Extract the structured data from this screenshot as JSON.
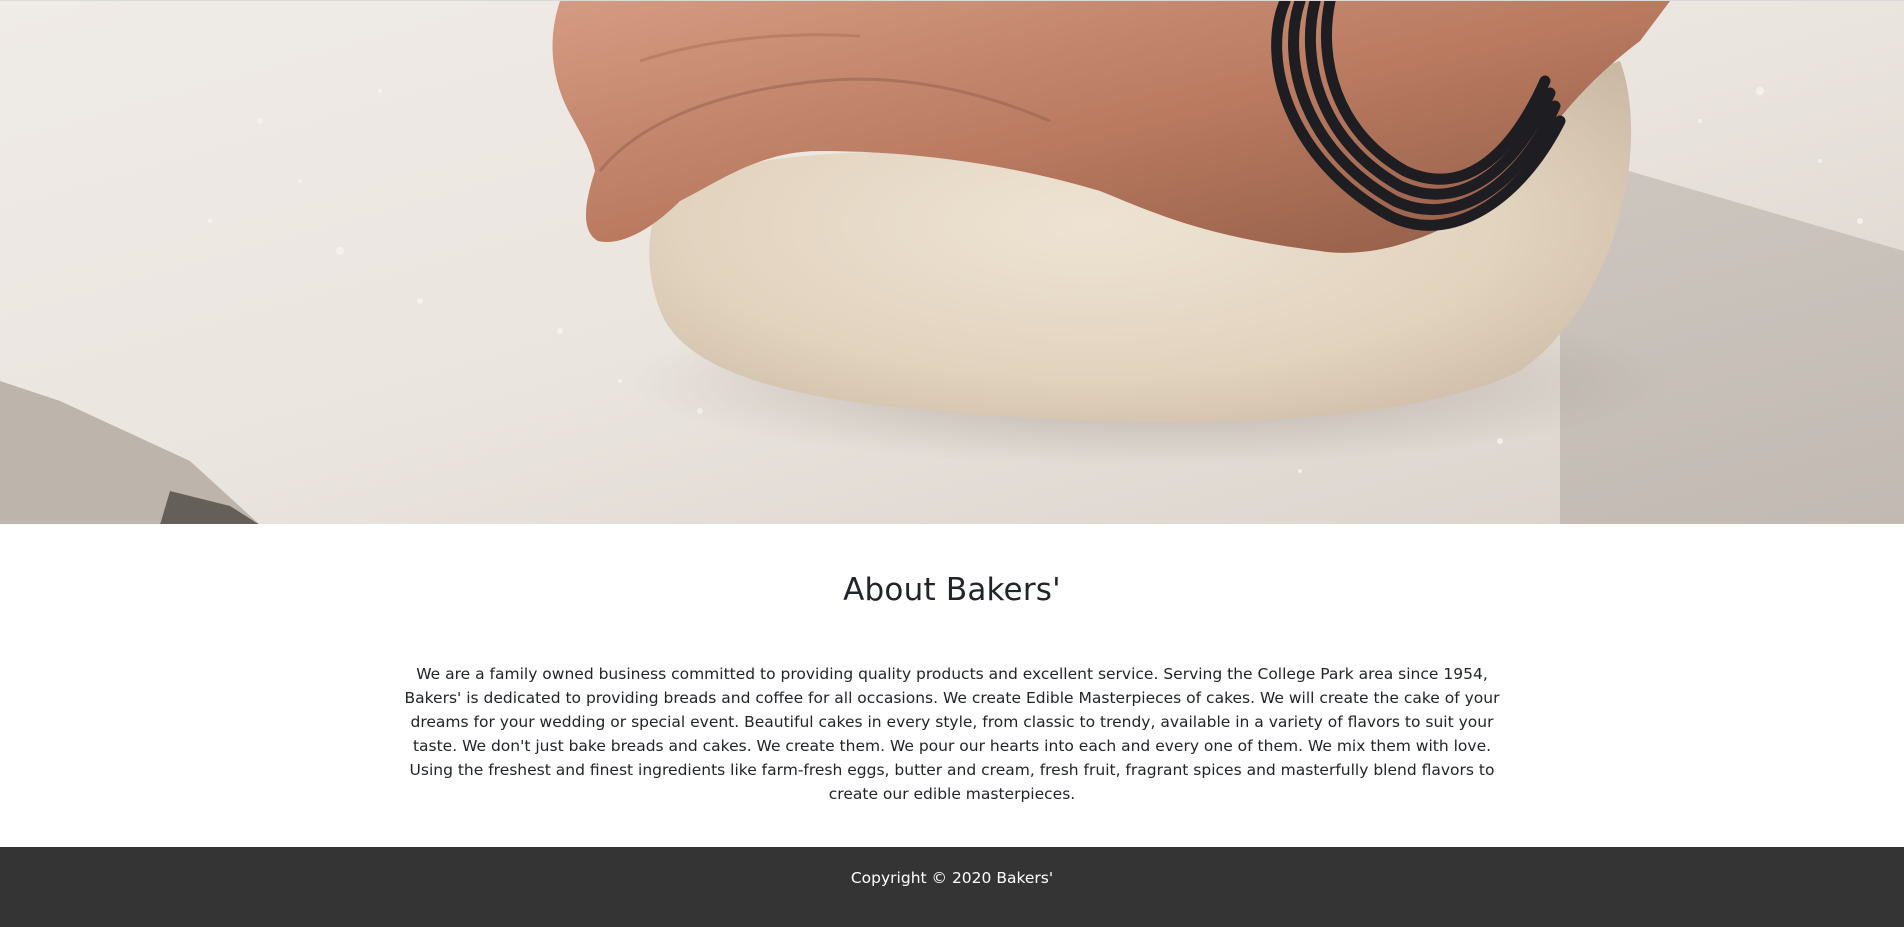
{
  "hero": {
    "image_description_icon": "dough-kneading-photo",
    "colors": {
      "flour_bg": "#ece7e2",
      "dough": "#e5d7c4",
      "skin": "#c9876c",
      "band": "#1e1e22"
    }
  },
  "about": {
    "title": "About Bakers'",
    "paragraph": "We are a family owned business committed to providing quality products and excellent service. Serving the College Park area since 1954, Bakers' is dedicated to providing breads and coffee for all occasions. We create Edible Masterpieces of cakes. We will create the cake of your dreams for your wedding or special event. Beautiful cakes in every style, from classic to trendy, available in a variety of flavors to suit your taste. We don't just bake breads and cakes. We create them. We pour our hearts into each and every one of them. We mix them with love. Using the freshest and finest ingredients like farm-fresh eggs, butter and cream, fresh fruit, fragrant spices and masterfully blend flavors to create our edible masterpieces."
  },
  "footer": {
    "copyright": "Copyright © 2020 Bakers'",
    "background": "#343434"
  }
}
